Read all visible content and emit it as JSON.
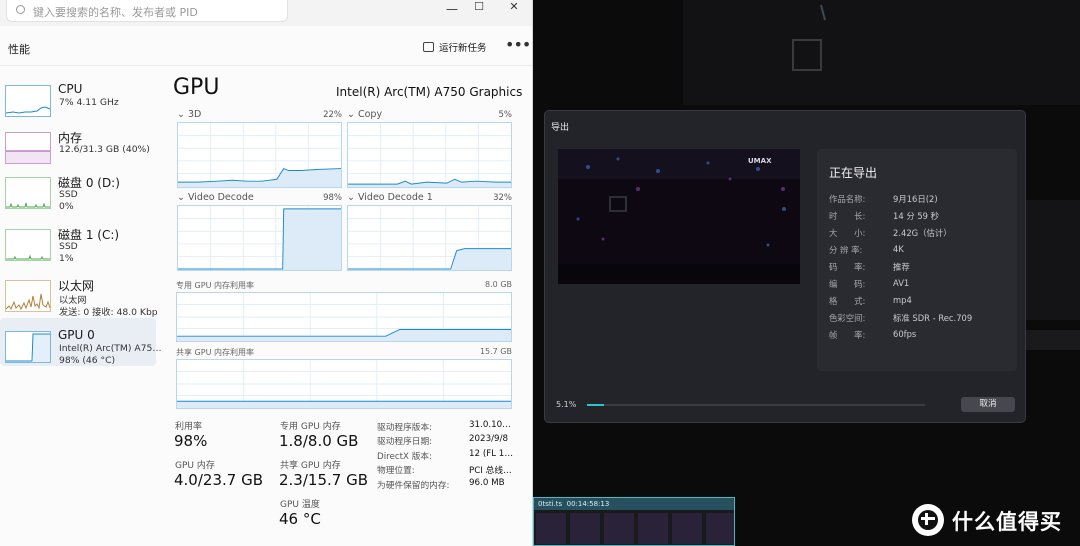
{
  "task_manager": {
    "search_placeholder": "键入要搜索的名称、发布者或 PID",
    "window_controls": {
      "minimize": "—",
      "maximize": "☐",
      "close": "✕"
    },
    "page_title": "性能",
    "run_new_task": "运行新任务",
    "more": "•••",
    "sidebar": [
      {
        "label": "CPU",
        "sub1": "7%  4.11 GHz",
        "sub2": ""
      },
      {
        "label": "内存",
        "sub1": "12.6/31.3 GB (40%)",
        "sub2": ""
      },
      {
        "label": "磁盘 0 (D:)",
        "sub1": "SSD",
        "sub2": "0%"
      },
      {
        "label": "磁盘 1 (C:)",
        "sub1": "SSD",
        "sub2": "1%"
      },
      {
        "label": "以太网",
        "sub1": "以太网",
        "sub2": "发送: 0 接收: 48.0 Kbp"
      },
      {
        "label": "GPU 0",
        "sub1": "Intel(R) Arc(TM) A75…",
        "sub2": "98% (46 °C)"
      }
    ],
    "gpu": {
      "title": "GPU",
      "model": "Intel(R) Arc(TM) A750 Graphics",
      "engines": [
        {
          "label": "3D",
          "pct": "22%"
        },
        {
          "label": "Copy",
          "pct": "5%"
        },
        {
          "label": "Video Decode",
          "pct": "98%"
        },
        {
          "label": "Video Decode 1",
          "pct": "32%"
        }
      ],
      "dedicated_mem_label": "专用 GPU 内存利用率",
      "dedicated_mem_max": "8.0 GB",
      "shared_mem_label": "共享 GPU 内存利用率",
      "shared_mem_max": "15.7 GB",
      "stats": {
        "utilization_label": "利用率",
        "utilization": "98%",
        "dedicated_label": "专用 GPU 内存",
        "dedicated": "1.8/8.0 GB",
        "gpu_mem_label": "GPU 内存",
        "gpu_mem": "4.0/23.7 GB",
        "shared_label": "共享 GPU 内存",
        "shared": "2.3/15.7 GB",
        "temp_label": "GPU 温度",
        "temp": "46 °C"
      },
      "details": [
        {
          "k": "驱动程序版本:",
          "v": "31.0.10…"
        },
        {
          "k": "驱动程序日期:",
          "v": "2023/9/8"
        },
        {
          "k": "DirectX 版本:",
          "v": "12 (FL 1…"
        },
        {
          "k": "物理位置:",
          "v": "PCI 总线…"
        },
        {
          "k": "为硬件保留的内存:",
          "v": "96.0 MB"
        }
      ]
    }
  },
  "export_dialog": {
    "title": "导出",
    "status_title": "正在导出",
    "info": [
      {
        "k": "作品名称:",
        "v": "9月16日(2)"
      },
      {
        "k": "时　　长:",
        "v": "14 分 59 秒"
      },
      {
        "k": "大　　小:",
        "v": "2.42G（估计）"
      },
      {
        "k": "分 辨 率:",
        "v": "4K"
      },
      {
        "k": "码　　率:",
        "v": "推荐"
      },
      {
        "k": "编　　码:",
        "v": "AV1"
      },
      {
        "k": "格　　式:",
        "v": "mp4"
      },
      {
        "k": "色彩空间:",
        "v": "标准 SDR - Rec.709"
      },
      {
        "k": "帧　　率:",
        "v": "60fps"
      }
    ],
    "progress_text": "5.1%",
    "progress": 0.051,
    "cancel": "取消",
    "thumb_text": "UMAX"
  },
  "timeline": {
    "clip_name": "0tsti.ts",
    "clip_time": "00:14:58:13"
  },
  "watermark": {
    "text": "什么值得买"
  },
  "colors": {
    "graph_line": "#1a8ad4",
    "memory_line": "#a04aa8",
    "disk_line": "#4ca84c",
    "eth_line": "#b0803a",
    "accent": "#2fc4c8"
  }
}
